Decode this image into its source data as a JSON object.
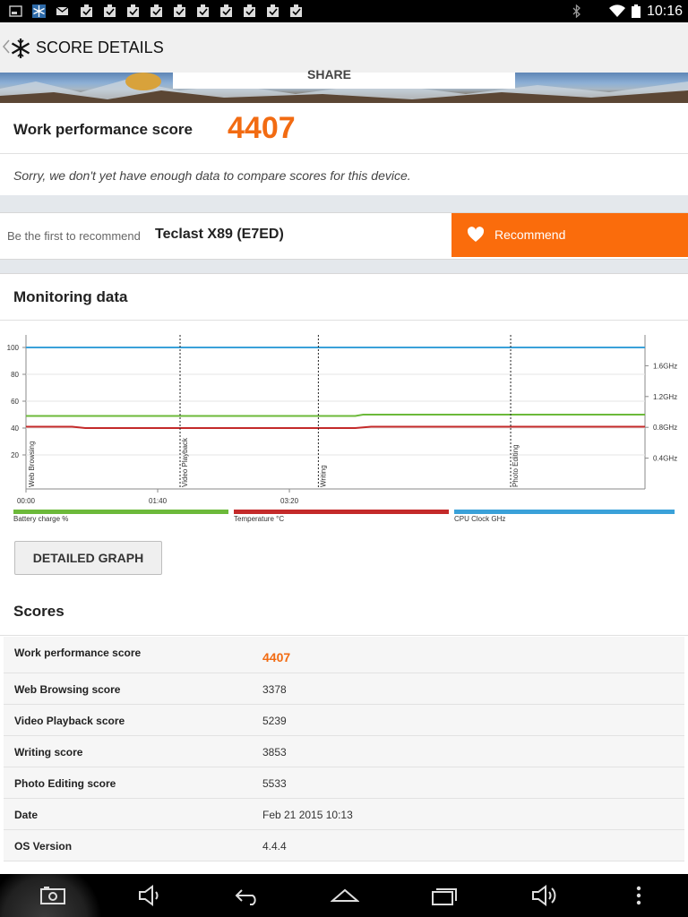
{
  "status_bar": {
    "time": "10:16",
    "left_icons": [
      "screenshot-icon",
      "snowflake-icon",
      "gmail-icon",
      "check-icon",
      "check-icon",
      "check-icon",
      "check-icon",
      "check-icon",
      "check-icon",
      "check-icon",
      "check-icon",
      "check-icon",
      "check-icon"
    ],
    "right_icons": [
      "bluetooth-icon",
      "wifi-icon",
      "battery-icon"
    ]
  },
  "action_bar": {
    "title": "SCORE DETAILS",
    "back_icon": "chevron-left-icon",
    "app_icon": "snowflake-icon"
  },
  "banner": {
    "share_label": "SHARE"
  },
  "score_card": {
    "label": "Work performance score",
    "value": "4407",
    "message": "Sorry, we don't yet have enough data to compare scores for this device."
  },
  "recommend": {
    "prefix": "Be the first to recommend",
    "device": "Teclast X89 (E7ED)",
    "button_label": "Recommend",
    "button_icon": "heart-icon"
  },
  "monitoring": {
    "heading": "Monitoring data",
    "detailed_button": "DETAILED GRAPH",
    "legend": [
      {
        "label": "Battery charge %",
        "color": "#6cb93a"
      },
      {
        "label": "Temperature °C",
        "color": "#c42a2a"
      },
      {
        "label": "CPU Clock GHz",
        "color": "#3aa1d9"
      }
    ]
  },
  "chart_data": {
    "type": "line",
    "x_ticks": [
      "00:00",
      "01:40",
      "03:20"
    ],
    "y_ticks_left": [
      "100",
      "80",
      "60",
      "40",
      "20"
    ],
    "y_ticks_right": [
      "1.6GHz",
      "1.2GHz",
      "0.8GHz",
      "0.4GHz"
    ],
    "ylim": [
      0,
      100
    ],
    "xlim_seconds": [
      0,
      470
    ],
    "sections": [
      {
        "label": "Web Browsing",
        "start_seconds": 0
      },
      {
        "label": "Video Playback",
        "start_seconds": 117
      },
      {
        "label": "Writing",
        "start_seconds": 222
      },
      {
        "label": "Photo Editing",
        "start_seconds": 368
      }
    ],
    "series": [
      {
        "name": "Battery charge %",
        "color": "#6cb93a",
        "points": [
          [
            0,
            49
          ],
          [
            250,
            49
          ],
          [
            256,
            50
          ],
          [
            470,
            50
          ]
        ]
      },
      {
        "name": "Temperature °C",
        "color": "#c42a2a",
        "points": [
          [
            0,
            41
          ],
          [
            35,
            41
          ],
          [
            45,
            40
          ],
          [
            250,
            40
          ],
          [
            262,
            41
          ],
          [
            470,
            41
          ]
        ]
      },
      {
        "name": "CPU Clock GHz",
        "color": "#3aa1d9",
        "points": [
          [
            0,
            100
          ],
          [
            470,
            100
          ]
        ]
      }
    ]
  },
  "scores": {
    "heading": "Scores",
    "rows": [
      {
        "label": "Work performance score",
        "value": "4407",
        "highlight": true
      },
      {
        "label": "Web Browsing score",
        "value": "3378"
      },
      {
        "label": "Video Playback score",
        "value": "5239"
      },
      {
        "label": "Writing score",
        "value": "3853"
      },
      {
        "label": "Photo Editing score",
        "value": "5533"
      },
      {
        "label": "Date",
        "value": "Feb 21 2015 10:13"
      },
      {
        "label": "OS Version",
        "value": "4.4.4"
      }
    ]
  },
  "nav_bar": {
    "icons": [
      "camera-icon",
      "volume-down-icon",
      "back-icon",
      "home-icon",
      "recent-apps-icon",
      "volume-up-icon",
      "menu-icon"
    ]
  }
}
